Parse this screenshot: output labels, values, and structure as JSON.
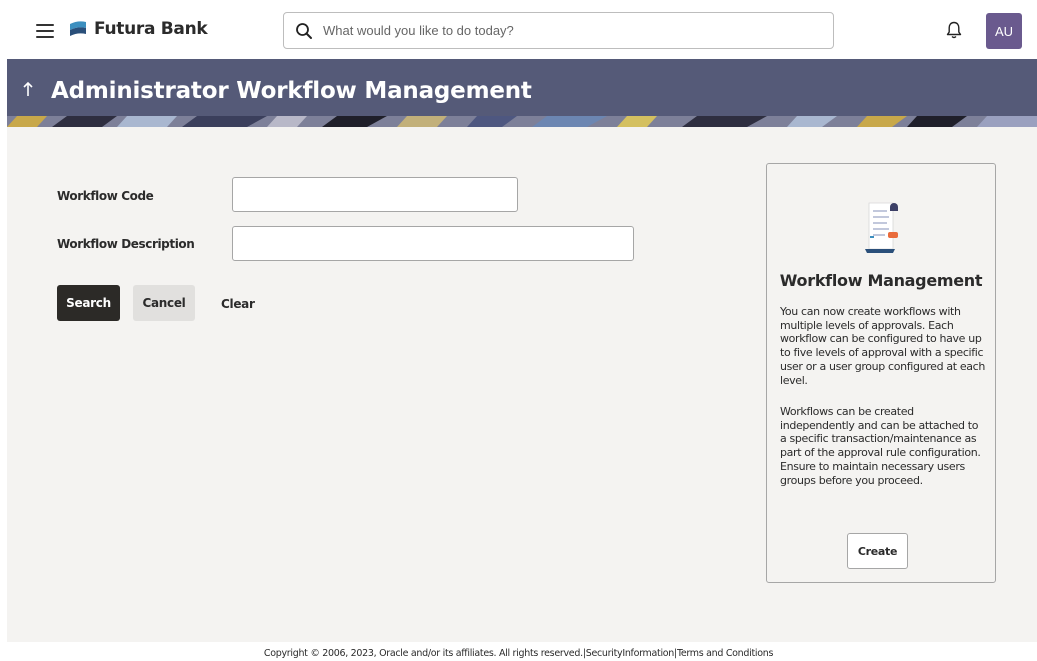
{
  "header": {
    "brand": "Futura Bank",
    "search_placeholder": "What would you like to do today?",
    "avatar_initials": "AU",
    "menu_icon": "hamburger-icon",
    "notification_icon": "bell-icon",
    "search_icon": "search-icon"
  },
  "page": {
    "title": "Administrator Workflow Management",
    "back_icon": "arrow-up-icon"
  },
  "form": {
    "workflow_code_label": "Workflow Code",
    "workflow_code_value": "",
    "workflow_description_label": "Workflow Description",
    "workflow_description_value": "",
    "search_label": "Search",
    "cancel_label": "Cancel",
    "clear_label": "Clear"
  },
  "info_card": {
    "title": "Workflow Management",
    "paragraph1": "You can now create workflows with multiple levels of approvals. Each workflow can be configured to have up to five levels of approval with a specific user or a user group configured at each level.",
    "paragraph2": "Workflows can be created independently and can be attached to a specific transaction/maintenance as part of the approval rule configuration. Ensure to maintain necessary users groups before you proceed.",
    "create_label": "Create",
    "illustration": "document-list-icon"
  },
  "footer": {
    "copyright": "Copyright © 2006, 2023, Oracle and/or its affiliates. All rights reserved.",
    "separator": "|",
    "security_link": "SecurityInformation",
    "terms_link": "Terms and Conditions"
  },
  "colors": {
    "hero_bg": "#555a78",
    "primary_button": "#2c2a27",
    "avatar_bg": "#6a5a8e",
    "content_bg": "#f4f3f1"
  }
}
